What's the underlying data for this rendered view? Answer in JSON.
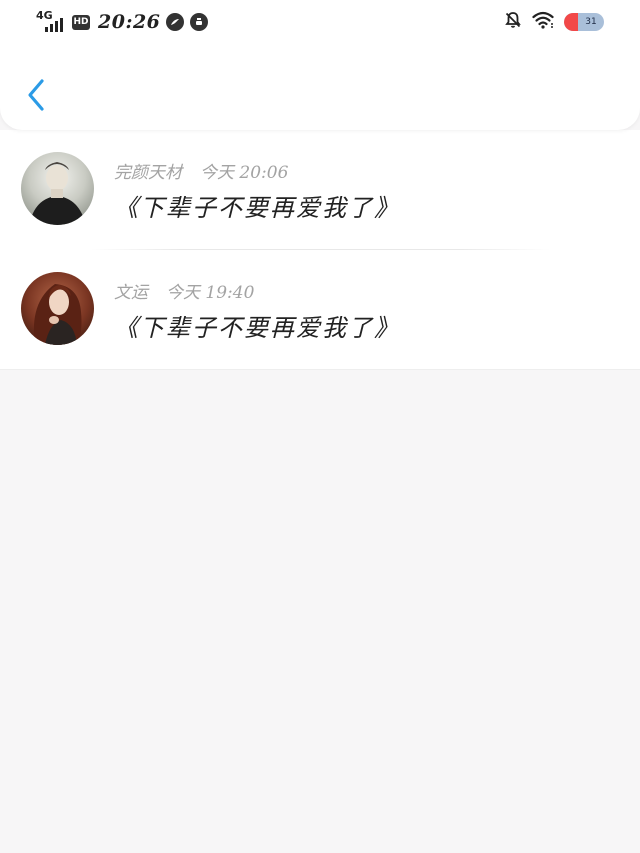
{
  "status_bar": {
    "network": "4G",
    "hd_badge": "HD",
    "time": "20:26",
    "battery_level": "31",
    "icons": [
      "signal-icon",
      "hd-icon",
      "app-notification-icon",
      "app-cup-icon",
      "mute-bell-icon",
      "wifi-icon",
      "battery-icon"
    ]
  },
  "header": {
    "back_icon": "chevron-left-icon",
    "accent_color": "#2b9be6"
  },
  "messages": [
    {
      "author": "完颜天材",
      "time": "今天 20:06",
      "content": "《下辈子不要再爱我了》"
    },
    {
      "author": "文运",
      "time": "今天 19:40",
      "content": "《下辈子不要再爱我了》"
    }
  ]
}
